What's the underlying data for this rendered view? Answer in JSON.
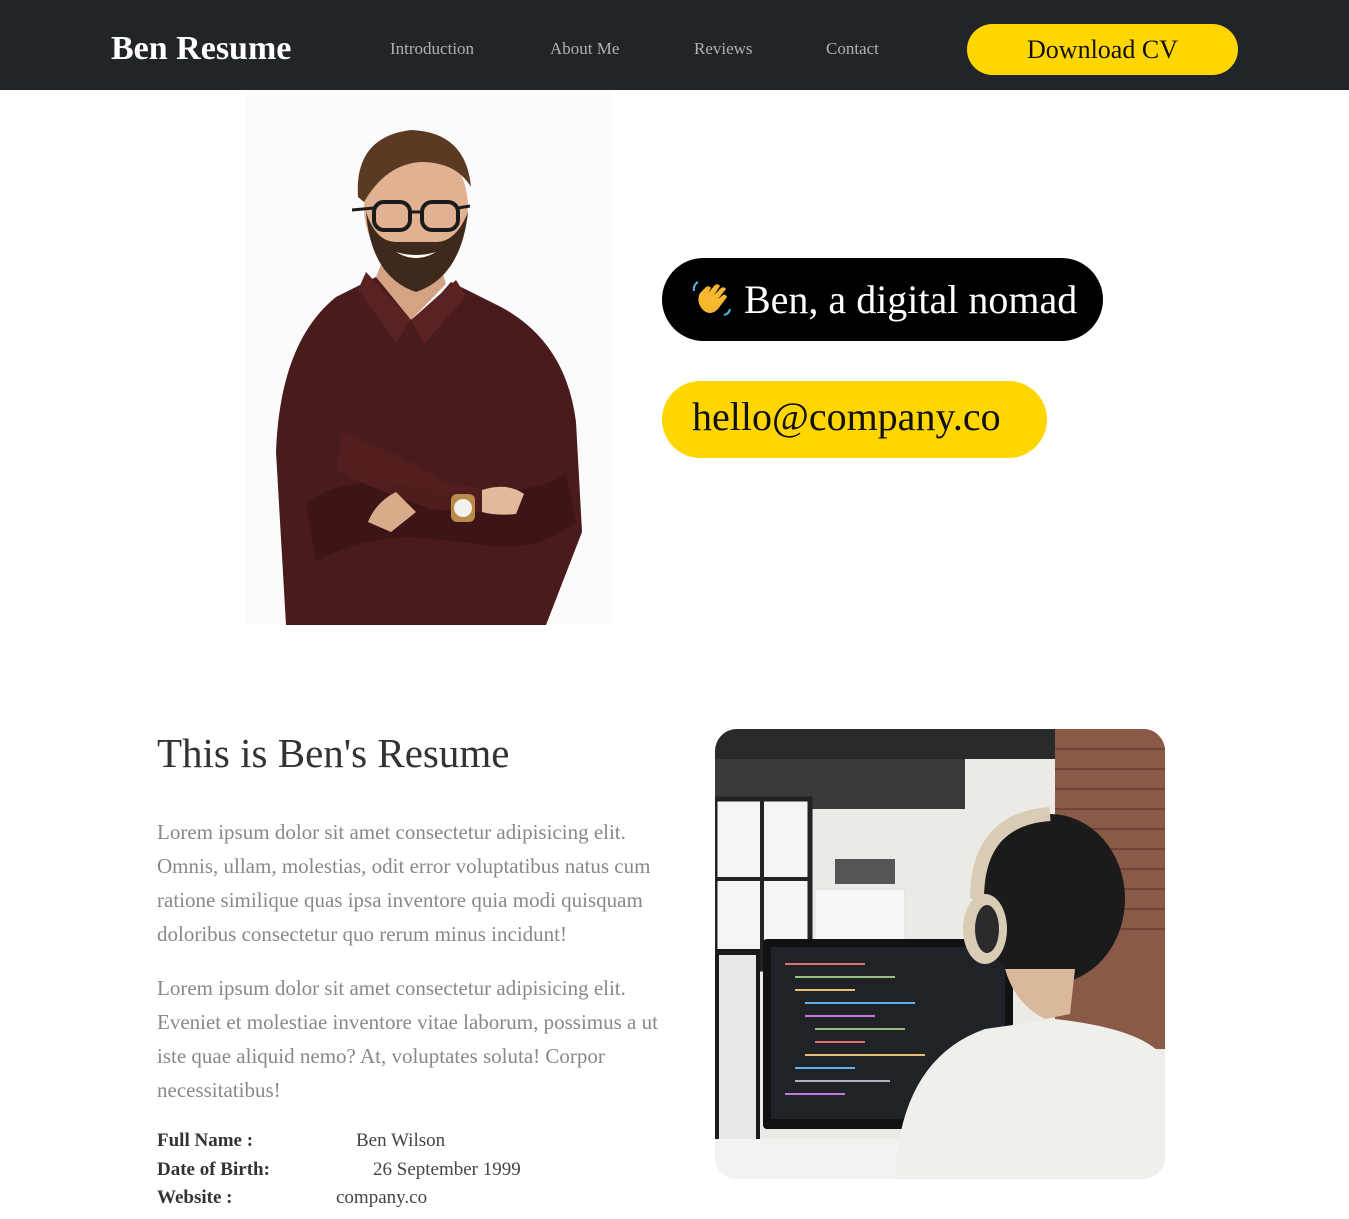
{
  "navbar": {
    "brand": "Ben Resume",
    "links": [
      "Introduction",
      "About Me",
      "Reviews",
      "Contact"
    ],
    "cta_label": "Download CV"
  },
  "hero": {
    "greeting_icon": "waving-hand-icon",
    "greeting": "Ben, a digital nomad",
    "email": "hello@company.co"
  },
  "about": {
    "title": "This is Ben's Resume",
    "paragraphs": [
      "Lorem ipsum dolor sit amet consectetur adipisicing elit. Omnis, ullam, molestias, odit error voluptatibus natus cum ratione similique quas ipsa inventore quia modi quisquam doloribus consectetur quo rerum minus incidunt!",
      "Lorem ipsum dolor sit amet consectetur adipisicing elit. Eveniet et molestiae inventore vitae laborum, possimus a ut iste quae aliquid nemo? At, voluptates soluta! Corpor necessitatibus!"
    ],
    "details": [
      {
        "label": "Full Name :",
        "value": "Ben Wilson"
      },
      {
        "label": "Date of Birth:",
        "value": "26 September 1999"
      },
      {
        "label": "Website :",
        "value": "company.co"
      }
    ]
  },
  "colors": {
    "navbar_bg": "#212529",
    "accent_yellow": "#ffd600",
    "pill_black": "#000000",
    "muted_text": "#888888"
  }
}
